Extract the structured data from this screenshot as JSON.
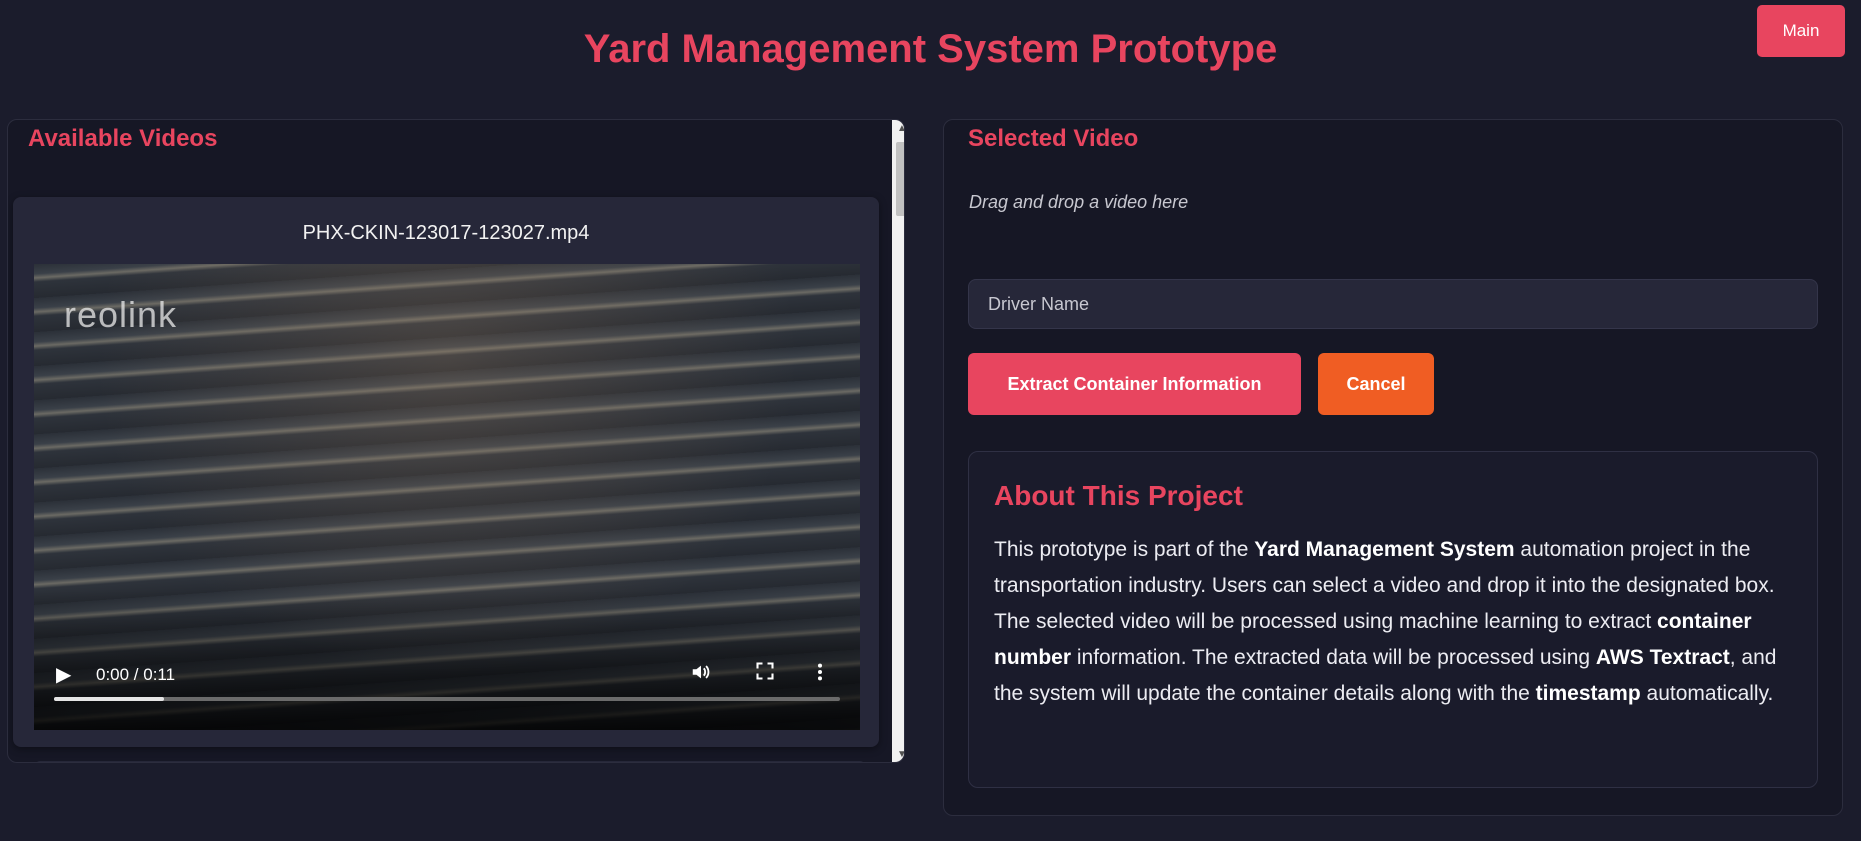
{
  "header": {
    "title": "Yard Management System Prototype",
    "main_button": "Main"
  },
  "available": {
    "heading": "Available Videos",
    "videos": [
      {
        "filename": "PHX-CKIN-123017-123027.mp4",
        "watermark": "reolink",
        "time": "0:00 / 0:11",
        "progress": 0.14
      }
    ]
  },
  "selected": {
    "heading": "Selected Video",
    "drop_hint": "Drag and drop a video here",
    "driver_placeholder": "Driver Name",
    "extract_button": "Extract Container Information",
    "cancel_button": "Cancel"
  },
  "about": {
    "title": "About This Project",
    "t1": "This prototype is part of the ",
    "b1": "Yard Management System",
    "t2": " automation project in the transportation industry. Users can select a video and drop it into the designated box. The selected video will be processed using machine learning to extract ",
    "b2": "container number",
    "t3": " information. The extracted data will be processed using ",
    "b3": "AWS Textract",
    "t4": ", and the system will update the container details along with the ",
    "b4": "timestamp",
    "t5": " automatically."
  },
  "colors": {
    "accent": "#e8455f",
    "cancel": "#f05d23",
    "background": "#1b1c2c",
    "panel": "#161725"
  },
  "icons": {
    "play": "play-icon",
    "volume": "volume-icon",
    "fullscreen": "fullscreen-icon",
    "more": "more-vert-icon"
  }
}
